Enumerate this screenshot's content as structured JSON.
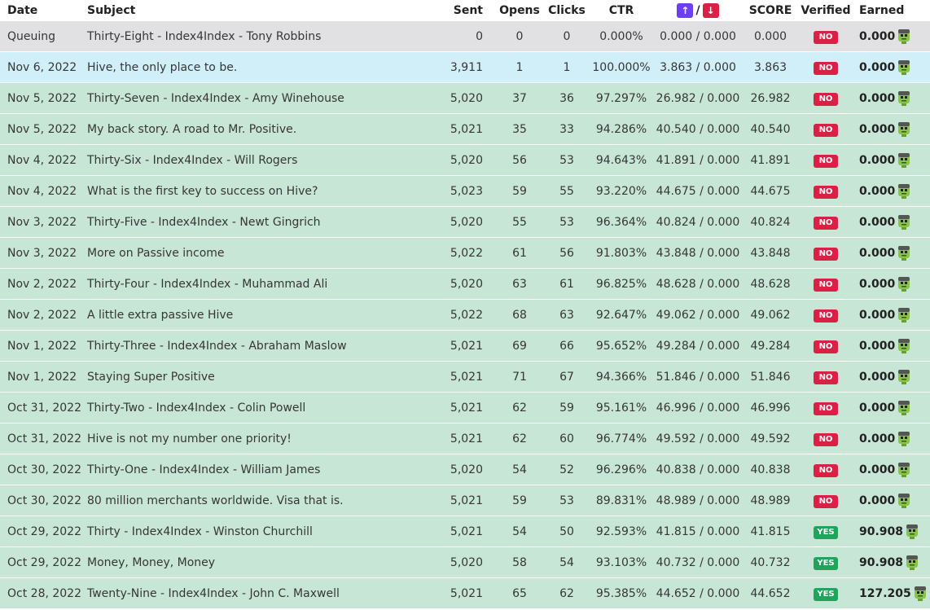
{
  "headers": {
    "date": "Date",
    "subject": "Subject",
    "sent": "Sent",
    "opens": "Opens",
    "clicks": "Clicks",
    "ctr": "CTR",
    "sort_up_icon": "arrow-up-icon",
    "sort_slash": "/",
    "sort_down_icon": "arrow-down-icon",
    "score": "SCORE",
    "verified": "Verified",
    "earned": "Earned"
  },
  "colors": {
    "queue_row": "#e1e1e3",
    "current_row": "#d1eff8",
    "done_row": "#c8e6d6",
    "no_badge": "#dc1f45",
    "yes_badge": "#21a35c",
    "sort_up": "#6e3ef2",
    "sort_down": "#dc1f45"
  },
  "rows": [
    {
      "status": "queue",
      "date": "Queuing",
      "subject": "Thirty-Eight - Index4Index - Tony Robbins",
      "sent": "0",
      "opens": "0",
      "clicks": "0",
      "ctr": "0.000%",
      "ratio": "0.000 / 0.000",
      "score": "0.000",
      "verified": "NO",
      "earned": "0.000"
    },
    {
      "status": "current",
      "date": "Nov 6, 2022",
      "subject": "Hive, the only place to be.",
      "sent": "3,911",
      "opens": "1",
      "clicks": "1",
      "ctr": "100.000%",
      "ratio": "3.863 / 0.000",
      "score": "3.863",
      "verified": "NO",
      "earned": "0.000"
    },
    {
      "status": "done",
      "date": "Nov 5, 2022",
      "subject": "Thirty-Seven - Index4Index - Amy Winehouse",
      "sent": "5,020",
      "opens": "37",
      "clicks": "36",
      "ctr": "97.297%",
      "ratio": "26.982 / 0.000",
      "score": "26.982",
      "verified": "NO",
      "earned": "0.000"
    },
    {
      "status": "done",
      "date": "Nov 5, 2022",
      "subject": "My back story. A road to Mr. Positive.",
      "sent": "5,021",
      "opens": "35",
      "clicks": "33",
      "ctr": "94.286%",
      "ratio": "40.540 / 0.000",
      "score": "40.540",
      "verified": "NO",
      "earned": "0.000"
    },
    {
      "status": "done",
      "date": "Nov 4, 2022",
      "subject": "Thirty-Six - Index4Index - Will Rogers",
      "sent": "5,020",
      "opens": "56",
      "clicks": "53",
      "ctr": "94.643%",
      "ratio": "41.891 / 0.000",
      "score": "41.891",
      "verified": "NO",
      "earned": "0.000"
    },
    {
      "status": "done",
      "date": "Nov 4, 2022",
      "subject": "What is the first key to success on Hive?",
      "sent": "5,023",
      "opens": "59",
      "clicks": "55",
      "ctr": "93.220%",
      "ratio": "44.675 / 0.000",
      "score": "44.675",
      "verified": "NO",
      "earned": "0.000"
    },
    {
      "status": "done",
      "date": "Nov 3, 2022",
      "subject": "Thirty-Five - Index4Index - Newt Gingrich",
      "sent": "5,020",
      "opens": "55",
      "clicks": "53",
      "ctr": "96.364%",
      "ratio": "40.824 / 0.000",
      "score": "40.824",
      "verified": "NO",
      "earned": "0.000"
    },
    {
      "status": "done",
      "date": "Nov 3, 2022",
      "subject": "More on Passive income",
      "sent": "5,022",
      "opens": "61",
      "clicks": "56",
      "ctr": "91.803%",
      "ratio": "43.848 / 0.000",
      "score": "43.848",
      "verified": "NO",
      "earned": "0.000"
    },
    {
      "status": "done",
      "date": "Nov 2, 2022",
      "subject": "Thirty-Four - Index4Index - Muhammad Ali",
      "sent": "5,020",
      "opens": "63",
      "clicks": "61",
      "ctr": "96.825%",
      "ratio": "48.628 / 0.000",
      "score": "48.628",
      "verified": "NO",
      "earned": "0.000"
    },
    {
      "status": "done",
      "date": "Nov 2, 2022",
      "subject": "A little extra passive Hive",
      "sent": "5,022",
      "opens": "68",
      "clicks": "63",
      "ctr": "92.647%",
      "ratio": "49.062 / 0.000",
      "score": "49.062",
      "verified": "NO",
      "earned": "0.000"
    },
    {
      "status": "done",
      "date": "Nov 1, 2022",
      "subject": "Thirty-Three - Index4Index - Abraham Maslow",
      "sent": "5,021",
      "opens": "69",
      "clicks": "66",
      "ctr": "95.652%",
      "ratio": "49.284 / 0.000",
      "score": "49.284",
      "verified": "NO",
      "earned": "0.000"
    },
    {
      "status": "done",
      "date": "Nov 1, 2022",
      "subject": "Staying Super Positive",
      "sent": "5,021",
      "opens": "71",
      "clicks": "67",
      "ctr": "94.366%",
      "ratio": "51.846 / 0.000",
      "score": "51.846",
      "verified": "NO",
      "earned": "0.000"
    },
    {
      "status": "done",
      "date": "Oct 31, 2022",
      "subject": "Thirty-Two - Index4Index - Colin Powell",
      "sent": "5,021",
      "opens": "62",
      "clicks": "59",
      "ctr": "95.161%",
      "ratio": "46.996 / 0.000",
      "score": "46.996",
      "verified": "NO",
      "earned": "0.000"
    },
    {
      "status": "done",
      "date": "Oct 31, 2022",
      "subject": "Hive is not my number one priority!",
      "sent": "5,021",
      "opens": "62",
      "clicks": "60",
      "ctr": "96.774%",
      "ratio": "49.592 / 0.000",
      "score": "49.592",
      "verified": "NO",
      "earned": "0.000"
    },
    {
      "status": "done",
      "date": "Oct 30, 2022",
      "subject": "Thirty-One - Index4Index - William James",
      "sent": "5,020",
      "opens": "54",
      "clicks": "52",
      "ctr": "96.296%",
      "ratio": "40.838 / 0.000",
      "score": "40.838",
      "verified": "NO",
      "earned": "0.000"
    },
    {
      "status": "done",
      "date": "Oct 30, 2022",
      "subject": "80 million merchants worldwide. Visa that is.",
      "sent": "5,021",
      "opens": "59",
      "clicks": "53",
      "ctr": "89.831%",
      "ratio": "48.989 / 0.000",
      "score": "48.989",
      "verified": "NO",
      "earned": "0.000"
    },
    {
      "status": "done",
      "date": "Oct 29, 2022",
      "subject": "Thirty - Index4Index - Winston Churchill",
      "sent": "5,021",
      "opens": "54",
      "clicks": "50",
      "ctr": "92.593%",
      "ratio": "41.815 / 0.000",
      "score": "41.815",
      "verified": "YES",
      "earned": "90.908"
    },
    {
      "status": "done",
      "date": "Oct 29, 2022",
      "subject": "Money, Money, Money",
      "sent": "5,020",
      "opens": "58",
      "clicks": "54",
      "ctr": "93.103%",
      "ratio": "40.732 / 0.000",
      "score": "40.732",
      "verified": "YES",
      "earned": "90.908"
    },
    {
      "status": "done",
      "date": "Oct 28, 2022",
      "subject": "Twenty-Nine - Index4Index - John C. Maxwell",
      "sent": "5,021",
      "opens": "65",
      "clicks": "62",
      "ctr": "95.385%",
      "ratio": "44.652 / 0.000",
      "score": "44.652",
      "verified": "YES",
      "earned": "127.205"
    }
  ]
}
